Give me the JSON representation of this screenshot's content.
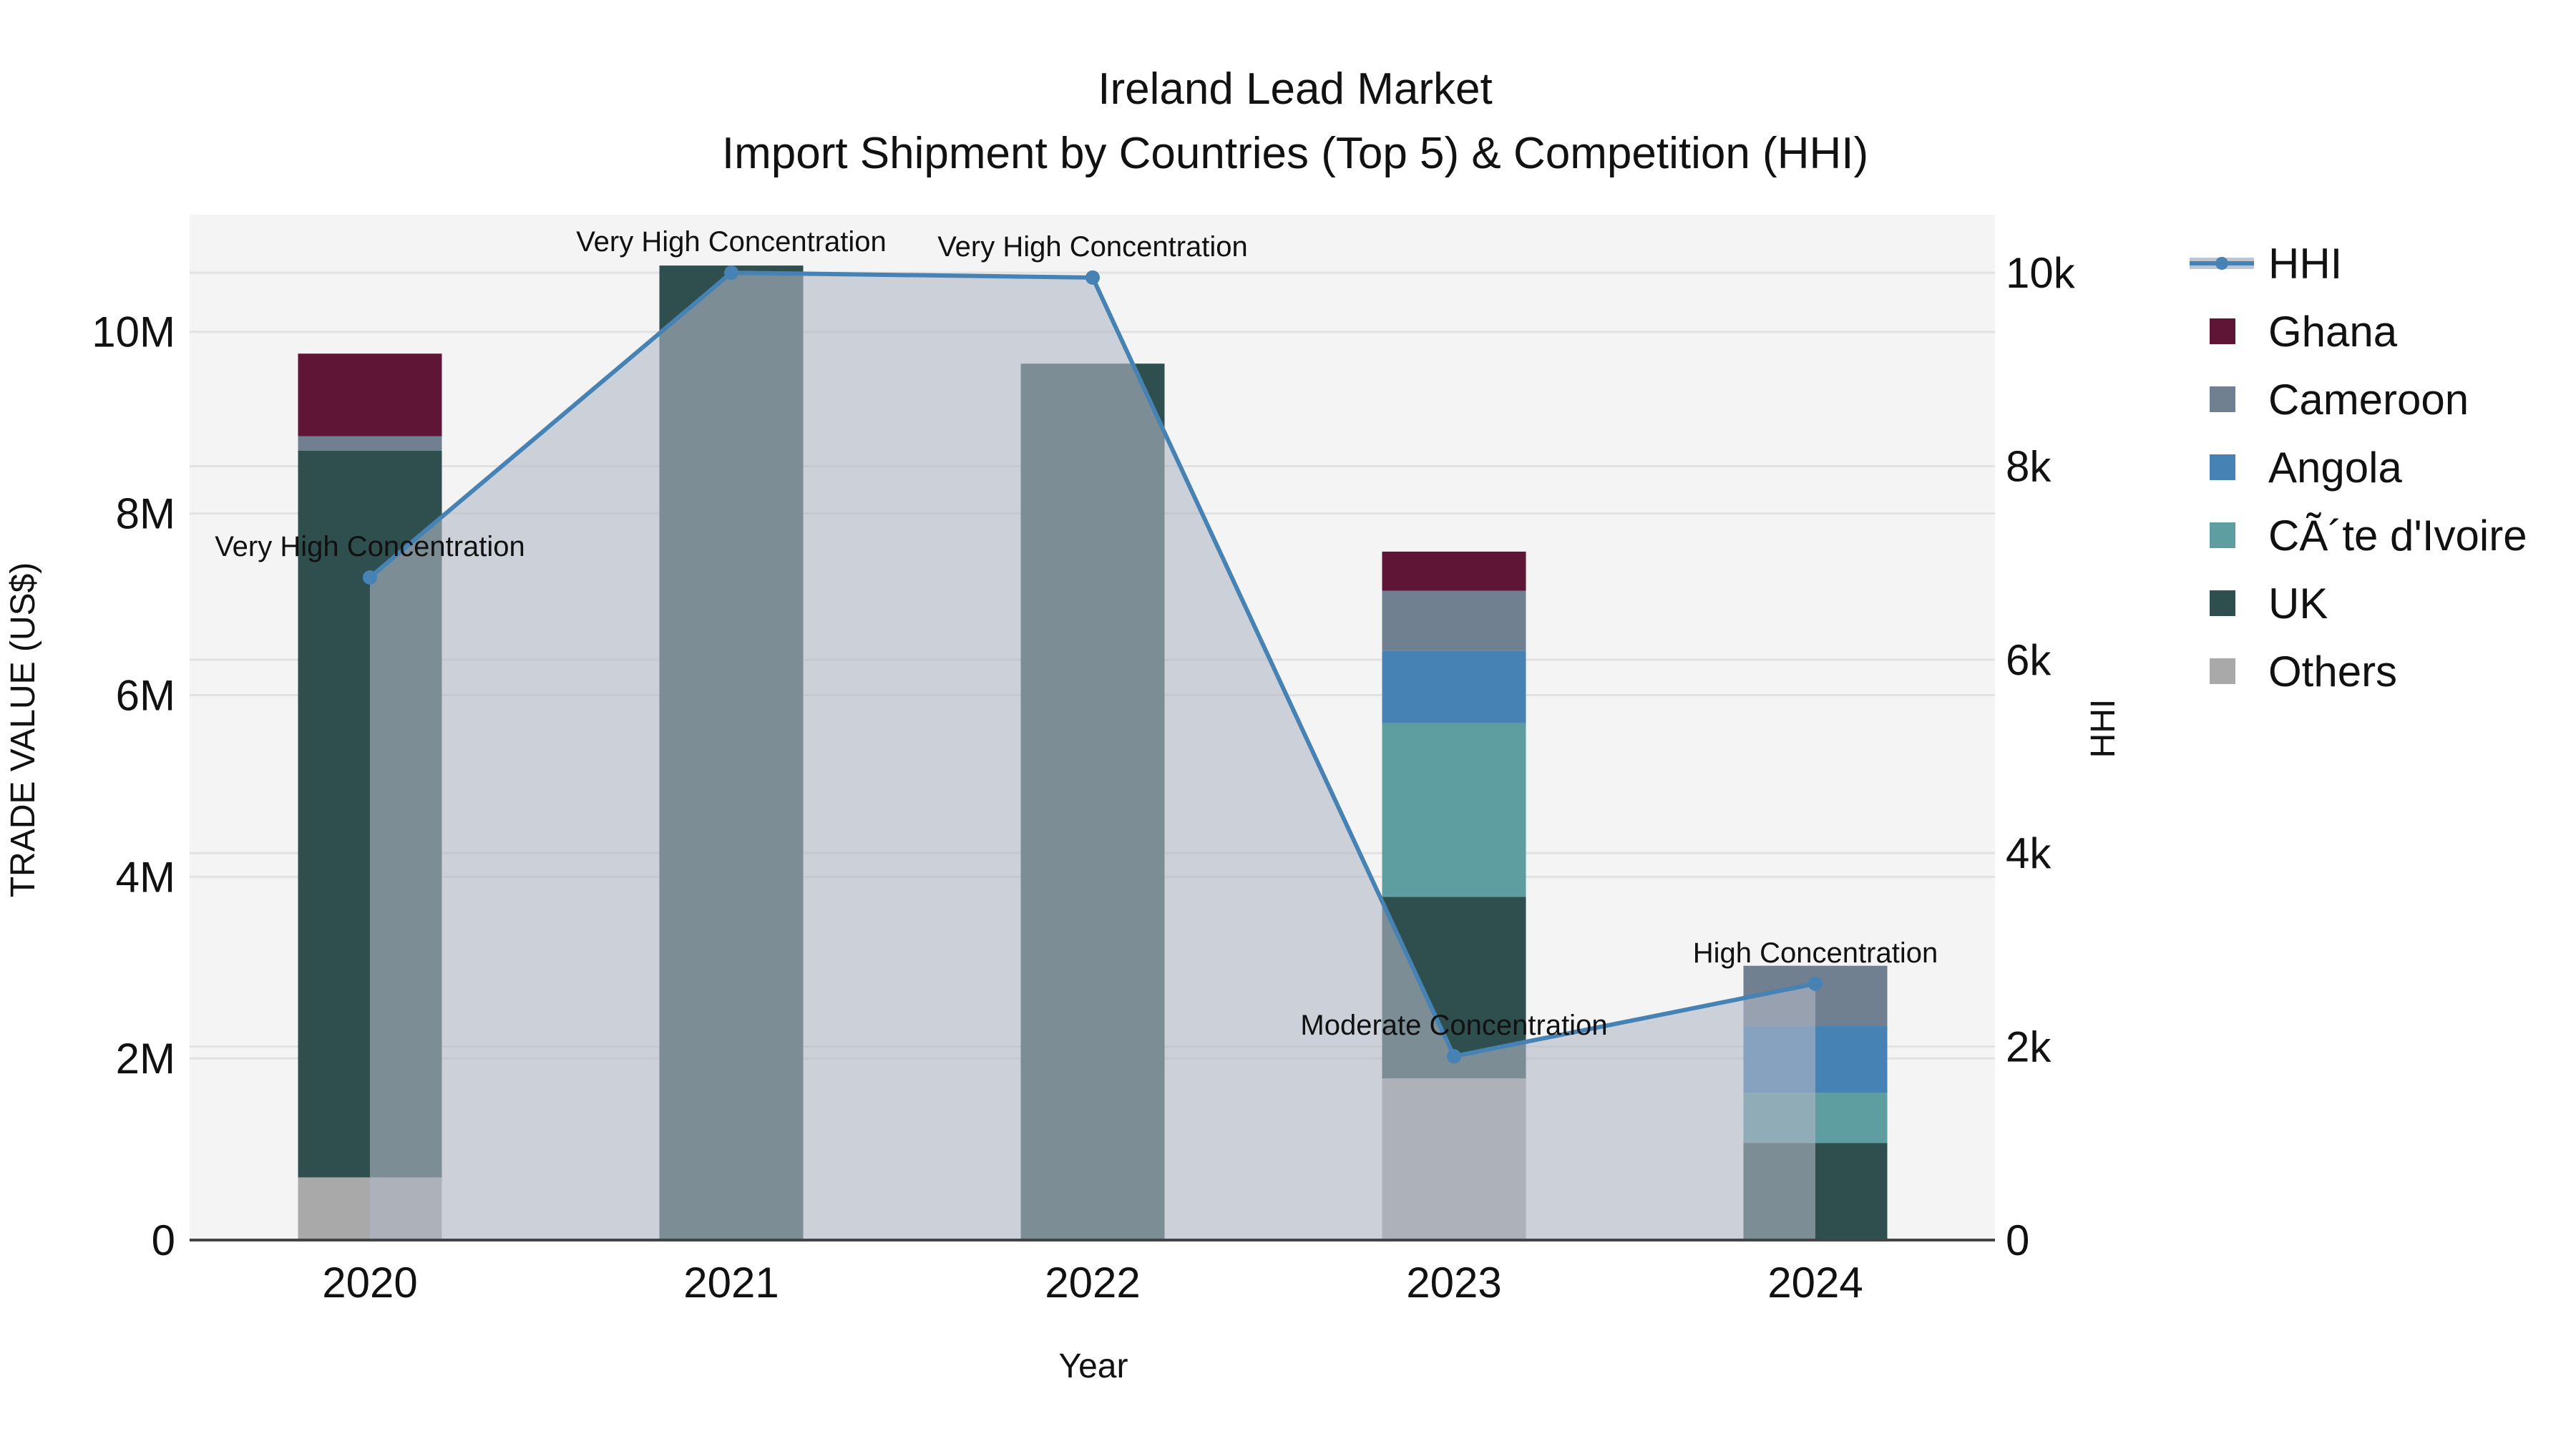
{
  "chart_data": {
    "type": "bar",
    "title": "Ireland Lead Market",
    "subtitle": "Import Shipment by Countries (Top 5) & Competition (HHI)",
    "xlabel": "Year",
    "ylabel": "TRADE VALUE (US$)",
    "y2label": "HHI",
    "categories": [
      "2020",
      "2021",
      "2022",
      "2023",
      "2024"
    ],
    "ylim": [
      0,
      11290000
    ],
    "y2lim": [
      0,
      10600
    ],
    "yticks": [
      {
        "v": 0,
        "label": "0"
      },
      {
        "v": 2000000,
        "label": "2M"
      },
      {
        "v": 4000000,
        "label": "4M"
      },
      {
        "v": 6000000,
        "label": "6M"
      },
      {
        "v": 8000000,
        "label": "8M"
      },
      {
        "v": 10000000,
        "label": "10M"
      }
    ],
    "y2ticks": [
      {
        "v": 0,
        "label": "0"
      },
      {
        "v": 2000,
        "label": "2k"
      },
      {
        "v": 4000,
        "label": "4k"
      },
      {
        "v": 6000,
        "label": "6k"
      },
      {
        "v": 8000,
        "label": "8k"
      },
      {
        "v": 10000,
        "label": "10k"
      }
    ],
    "grid": true,
    "legend_position": "right",
    "series": [
      {
        "name": "Others",
        "color": "#A9A9A9",
        "values": [
          690000,
          0,
          10000,
          1780000,
          0
        ]
      },
      {
        "name": "UK",
        "color": "#2F4F4F",
        "values": [
          8000000,
          10730000,
          9640000,
          2000000,
          1070000
        ]
      },
      {
        "name": "CÃ´te d'Ivoire",
        "color": "#5F9EA0",
        "values": [
          0,
          0,
          0,
          1910000,
          550000
        ]
      },
      {
        "name": "Angola",
        "color": "#4682B4",
        "values": [
          0,
          0,
          0,
          800000,
          740000
        ]
      },
      {
        "name": "Cameroon",
        "color": "#708090",
        "values": [
          160000,
          0,
          0,
          660000,
          660000
        ]
      },
      {
        "name": "Ghana",
        "color": "#5F1536",
        "values": [
          910000,
          0,
          0,
          430000,
          0
        ]
      }
    ],
    "hhi": {
      "name": "HHI",
      "color": "#4682B4",
      "values": [
        6850,
        10000,
        9950,
        1900,
        2650
      ],
      "annotations": [
        "Very High Concentration",
        "Very High Concentration",
        "Very High Concentration",
        "Moderate Concentration",
        "High Concentration"
      ]
    },
    "legend_order": [
      "HHI",
      "Ghana",
      "Cameroon",
      "Angola",
      "CÃ´te d'Ivoire",
      "UK",
      "Others"
    ]
  }
}
